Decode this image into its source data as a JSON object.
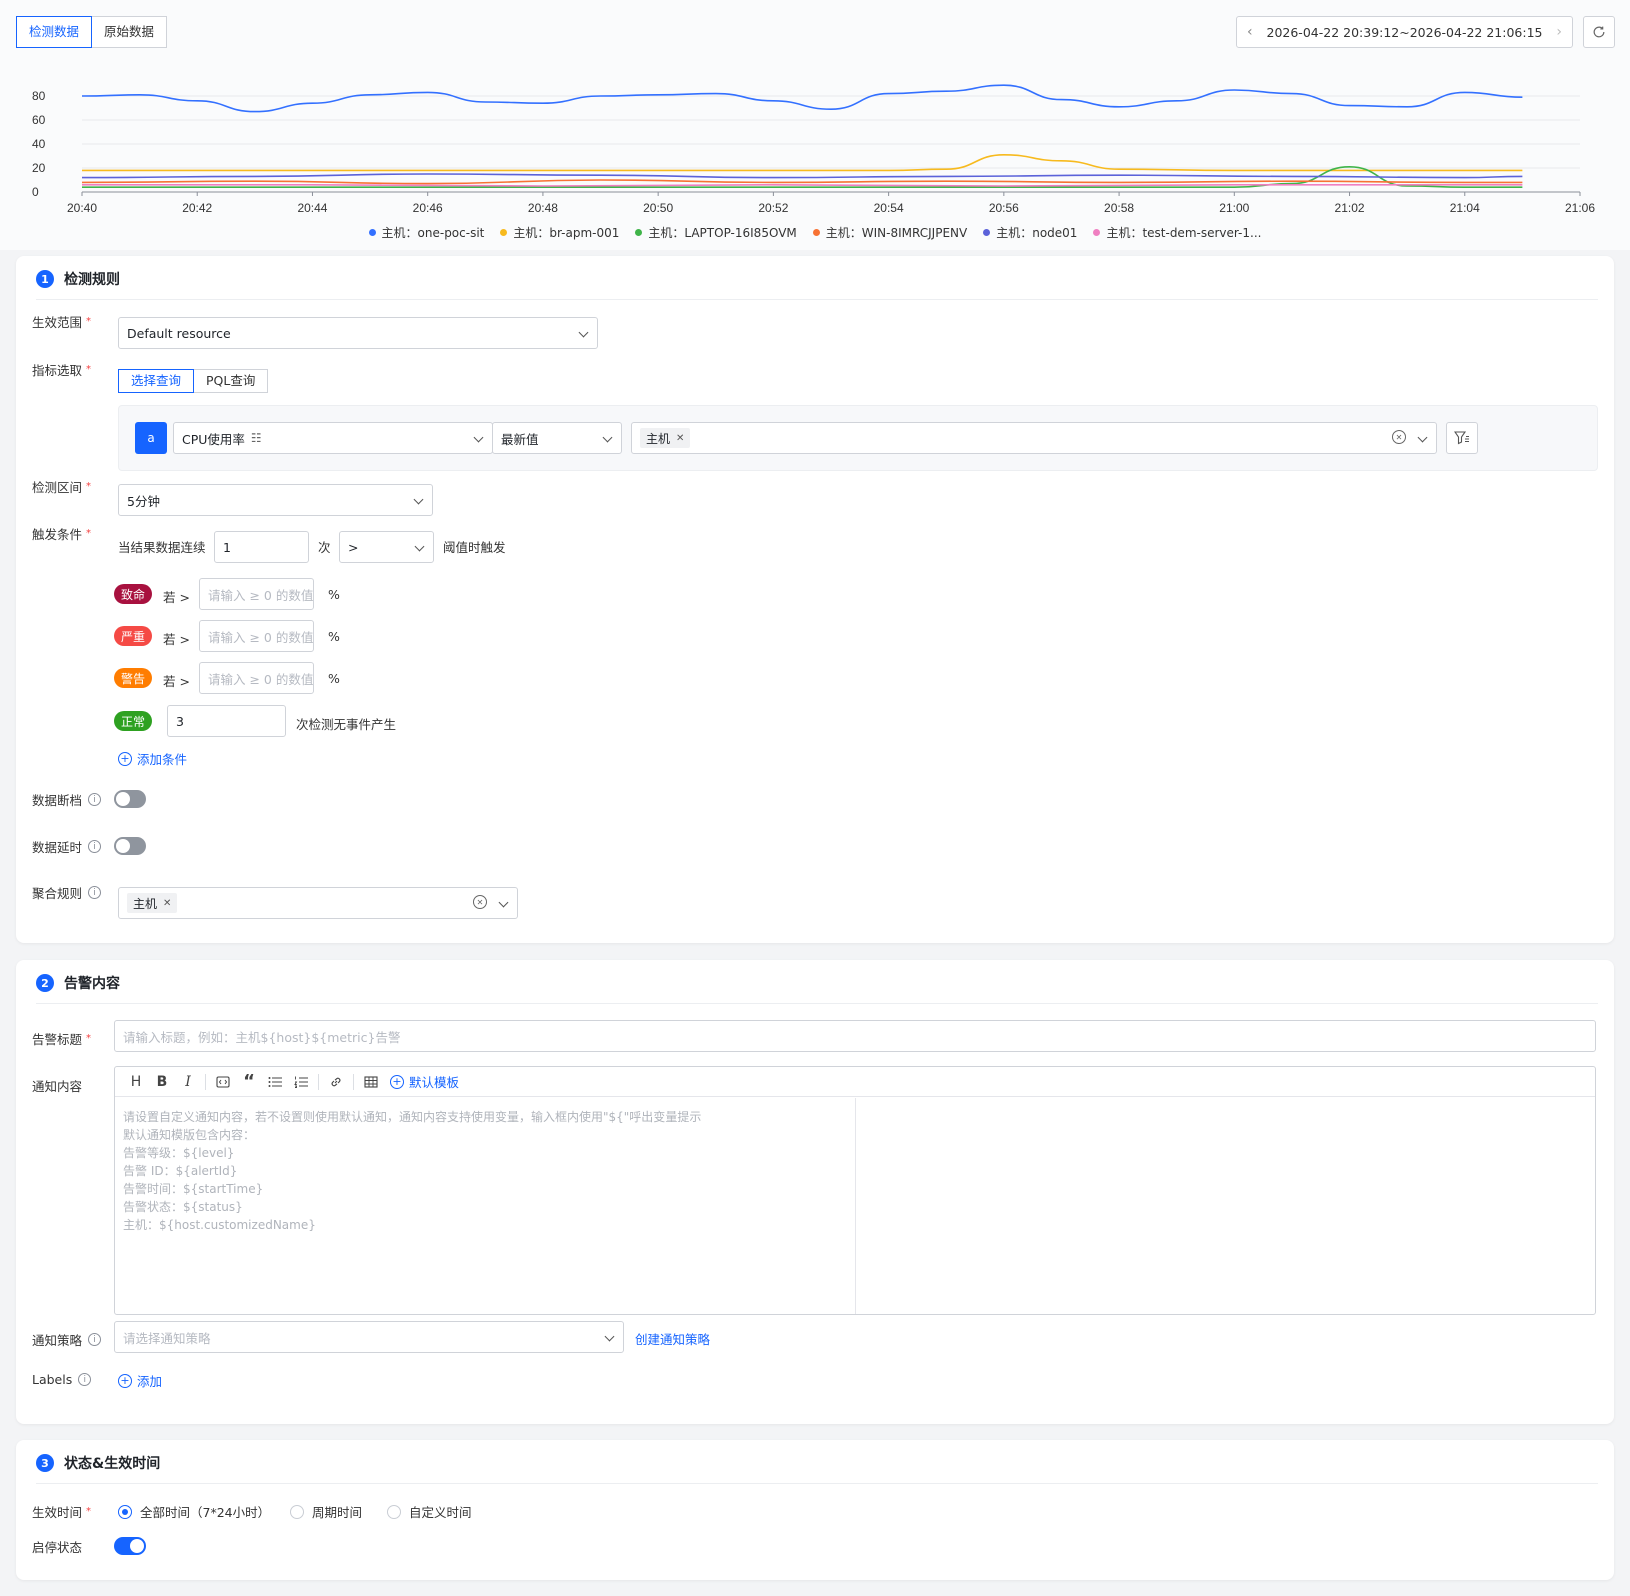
{
  "top_tabs": {
    "items": [
      "检测数据",
      "原始数据"
    ],
    "active": 0
  },
  "time_range": {
    "label": "2026-04-22 20:39:12~2026-04-22 21:06:15"
  },
  "chart_data": {
    "type": "line",
    "x": [
      "20:40",
      "20:42",
      "20:44",
      "20:46",
      "20:48",
      "20:50",
      "20:52",
      "20:54",
      "20:56",
      "20:58",
      "21:00",
      "21:02",
      "21:04",
      "21:06"
    ],
    "x_domain": [
      "20:40",
      "21:06"
    ],
    "ylim": [
      0,
      90
    ],
    "yticks": [
      0,
      20,
      40,
      60,
      80
    ],
    "grid": true,
    "legend": "bottom-center",
    "series": [
      {
        "name": "主机：one-poc-sit",
        "color": "#3370ff",
        "points": [
          [
            0,
            80
          ],
          [
            1,
            81
          ],
          [
            2,
            76
          ],
          [
            3,
            67
          ],
          [
            4,
            74
          ],
          [
            5,
            81
          ],
          [
            6,
            83
          ],
          [
            7,
            75
          ],
          [
            8,
            74
          ],
          [
            9,
            80
          ],
          [
            10,
            81
          ],
          [
            11,
            82
          ],
          [
            12,
            76
          ],
          [
            13,
            69
          ],
          [
            14,
            82
          ],
          [
            15,
            84
          ],
          [
            16,
            89
          ],
          [
            17,
            77
          ],
          [
            18,
            71
          ],
          [
            19,
            76
          ],
          [
            20,
            85
          ],
          [
            21,
            82
          ],
          [
            22,
            72
          ],
          [
            23,
            71
          ],
          [
            24,
            83
          ],
          [
            25,
            79
          ]
        ]
      },
      {
        "name": "主机：br-apm-001",
        "color": "#f7ba1e",
        "points": [
          [
            0,
            18
          ],
          [
            2,
            18
          ],
          [
            4,
            18
          ],
          [
            6,
            18
          ],
          [
            8,
            18
          ],
          [
            10,
            18
          ],
          [
            12,
            18
          ],
          [
            14,
            18
          ],
          [
            15,
            19
          ],
          [
            16,
            31
          ],
          [
            17,
            26
          ],
          [
            18,
            19
          ],
          [
            20,
            18
          ],
          [
            22,
            18
          ],
          [
            24,
            18
          ],
          [
            25,
            18
          ]
        ]
      },
      {
        "name": "主机：LAPTOP-16I85OVM",
        "color": "#3fb449",
        "points": [
          [
            0,
            4
          ],
          [
            3,
            4
          ],
          [
            6,
            4
          ],
          [
            9,
            4
          ],
          [
            12,
            4
          ],
          [
            15,
            4
          ],
          [
            18,
            4
          ],
          [
            20,
            4
          ],
          [
            21,
            7
          ],
          [
            22,
            21
          ],
          [
            23,
            5
          ],
          [
            24,
            4
          ],
          [
            25,
            4
          ]
        ]
      },
      {
        "name": "主机：WIN-8IMRCJJPENV",
        "color": "#f77234",
        "points": [
          [
            0,
            8
          ],
          [
            3,
            9
          ],
          [
            6,
            7
          ],
          [
            9,
            10
          ],
          [
            12,
            8
          ],
          [
            15,
            9
          ],
          [
            18,
            8
          ],
          [
            21,
            9
          ],
          [
            24,
            8
          ],
          [
            25,
            8
          ]
        ]
      },
      {
        "name": "主机：node01",
        "color": "#5b62d9",
        "points": [
          [
            0,
            12
          ],
          [
            3,
            13
          ],
          [
            6,
            15
          ],
          [
            9,
            14
          ],
          [
            12,
            12
          ],
          [
            15,
            13
          ],
          [
            18,
            14
          ],
          [
            21,
            13
          ],
          [
            24,
            12
          ],
          [
            25,
            13
          ]
        ]
      },
      {
        "name": "主机：test-dem-server-1...",
        "color": "#ef7fc1",
        "points": [
          [
            0,
            6
          ],
          [
            4,
            6
          ],
          [
            8,
            5
          ],
          [
            12,
            6
          ],
          [
            16,
            5
          ],
          [
            20,
            6
          ],
          [
            25,
            6
          ]
        ]
      }
    ]
  },
  "section1": {
    "number": "1",
    "title": "检测规则",
    "scope": {
      "label": "生效范围",
      "value": "Default resource"
    },
    "metric": {
      "label": "指标选取",
      "tabs": [
        "选择查询",
        "PQL查询"
      ],
      "query_tag": "a",
      "metric_value": "CPU使用率",
      "agg_value": "最新值",
      "group_tag": "主机"
    },
    "interval": {
      "label": "检测区间",
      "value": "5分钟"
    },
    "trigger": {
      "label": "触发条件",
      "prefix": "当结果数据连续",
      "count": "1",
      "unit": "次",
      "op": ">",
      "suffix": "阈值时触发",
      "levels": [
        {
          "name": "致命",
          "color": "#a8113f",
          "cmp": "若 >",
          "placeholder": "请输入 ≥ 0 的数值",
          "unit": "%"
        },
        {
          "name": "严重",
          "color": "#f54a45",
          "cmp": "若 >",
          "placeholder": "请输入 ≥ 0 的数值",
          "unit": "%"
        },
        {
          "name": "警告",
          "color": "#ff7d00",
          "cmp": "若 >",
          "placeholder": "请输入 ≥ 0 的数值",
          "unit": "%"
        }
      ],
      "normal": {
        "name": "正常",
        "color": "#2ea121",
        "value": "3",
        "suffix": "次检测无事件产生"
      },
      "add_label": "添加条件"
    },
    "data_gap": {
      "label": "数据断档",
      "on": false
    },
    "data_delay": {
      "label": "数据延时",
      "on": false
    },
    "aggregation": {
      "label": "聚合规则",
      "tag": "主机"
    }
  },
  "section2": {
    "number": "2",
    "title": "告警内容",
    "alert_title": {
      "label": "告警标题",
      "placeholder": "请输入标题，例如：主机${host}${metric}告警"
    },
    "notice": {
      "label": "通知内容",
      "template_label": "默认模板",
      "placeholder_lines": [
        "请设置自定义通知内容，若不设置则使用默认通知，通知内容支持使用变量，输入框内使用\"${\"呼出变量提示",
        "默认通知模版包含内容：",
        "告警等级：${level}",
        "告警 ID：${alertId}",
        "告警时间：${startTime}",
        "告警状态：${status}",
        "主机：${host.customizedName}"
      ]
    },
    "policy": {
      "label": "通知策略",
      "placeholder": "请选择通知策略",
      "create_label": "创建通知策略"
    },
    "labels": {
      "label": "Labels",
      "add_label": "添加"
    }
  },
  "section3": {
    "number": "3",
    "title": "状态&生效时间",
    "effective": {
      "label": "生效时间",
      "options": [
        "全部时间（7*24小时）",
        "周期时间",
        "自定义时间"
      ],
      "selected": 0
    },
    "status": {
      "label": "启停状态",
      "on": true
    }
  }
}
